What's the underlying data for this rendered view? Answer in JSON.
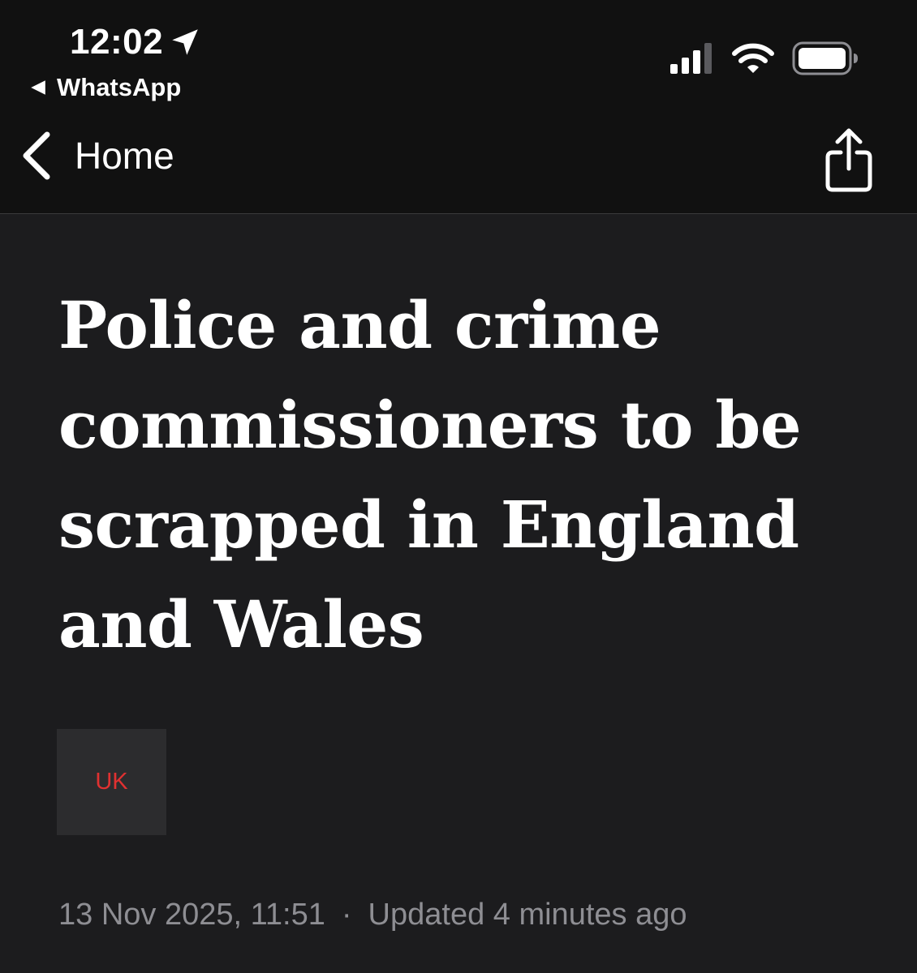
{
  "status_bar": {
    "time": "12:02",
    "back_app_label": "WhatsApp",
    "icons": [
      "location-arrow-icon",
      "cellular-signal-icon",
      "wifi-icon",
      "battery-icon"
    ]
  },
  "nav": {
    "back_label": "Home",
    "share_icon": "share-icon"
  },
  "article": {
    "headline": "Police and crime commissioners to be scrapped in England and Wales",
    "topic_tag": "UK",
    "published": "13 Nov 2025, 11:51",
    "separator": "·",
    "updated": "Updated 4 minutes ago"
  },
  "colors": {
    "background": "#1c1c1e",
    "top_bar": "#111111",
    "tag_background": "#2c2c2e",
    "tag_text": "#e03131",
    "meta_text": "#8e8e93"
  }
}
